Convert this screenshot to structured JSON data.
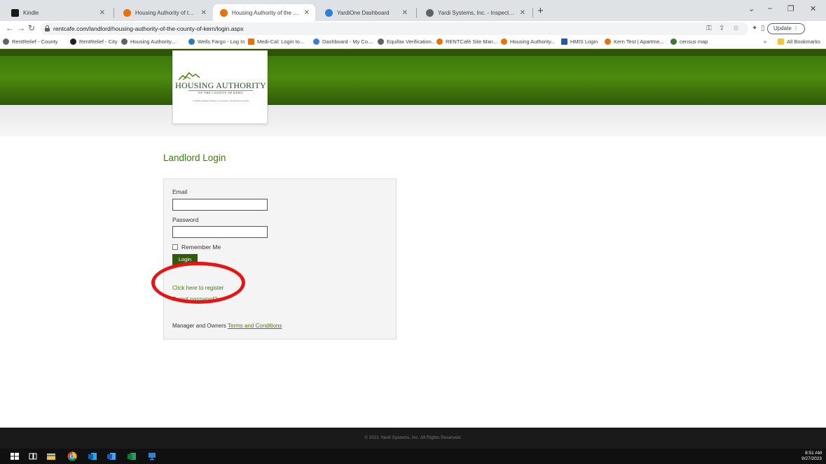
{
  "browser": {
    "tabs": [
      {
        "title": "Kindle",
        "active": false
      },
      {
        "title": "Housing Authority of the Count",
        "active": false
      },
      {
        "title": "Housing Authority of the Count",
        "active": true
      },
      {
        "title": "YardiOne Dashboard",
        "active": false
      },
      {
        "title": "Yardi Systems, Inc. - Inspection",
        "active": false
      }
    ],
    "new_tab_label": "+",
    "window_controls": {
      "minimize": "–",
      "restore": "❐",
      "close": "✕",
      "tab_search": "⌄"
    },
    "url": "rentcafe.com/landlord/housing-authority-of-the-county-of-kern/login.aspx",
    "update_label": "Update",
    "bookmarks": [
      "RentRelief - County",
      "RentRelief - City",
      "Housing Authority...",
      "Wells Fargo - Log In",
      "Medi-Cal: Login to...",
      "Dashboard - My Co...",
      "Equifax Verification...",
      "RENTCafé Site Man...",
      "Housing Authority...",
      "HMIS Login",
      "Kern Test | Apartme...",
      "census map"
    ],
    "bookmarks_overflow": "»",
    "all_bookmarks": "All Bookmarks"
  },
  "logo": {
    "name": "HOUSING AUTHORITY",
    "subtitle": "OF THE COUNTY OF KERN",
    "tagline": "Creating brighter futures...one home, one family at a time"
  },
  "login": {
    "title": "Landlord Login",
    "email_label": "Email",
    "email_value": "",
    "password_label": "Password",
    "password_value": "",
    "remember_label": "Remember Me",
    "login_button": "Login",
    "register_link": "Click here to register",
    "forgot_link": "Forgot password?",
    "terms_prefix": "Manager and Owners ",
    "terms_link": "Terms and Conditions"
  },
  "footer": {
    "copyright": "© 2021 Yardi Systems, Inc. All Rights Reserved."
  },
  "taskbar": {
    "time": "8:51 AM",
    "date": "9/27/2023"
  },
  "colors": {
    "brand_green": "#3f7a0c",
    "button_green": "#325a0e",
    "annotation_red": "#e81313"
  }
}
